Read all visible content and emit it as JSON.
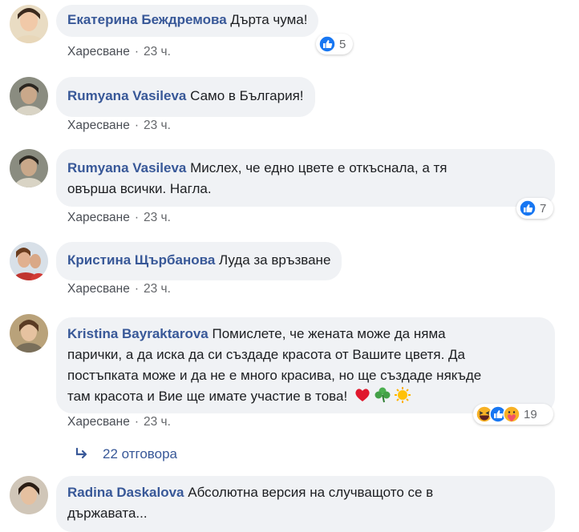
{
  "comments": [
    {
      "name": "Екатерина Беждремова",
      "text": " Дърта чума!",
      "like": "Харесване",
      "time": "23 ч.",
      "reactions": "5"
    },
    {
      "name": "Rumyana Vasileva",
      "text": " Само в България!",
      "like": "Харесване",
      "time": "23 ч."
    },
    {
      "name": "Rumyana Vasileva",
      "text": " Мислех, че едно цвете е откъснала, а тя",
      "text2": "овърша всички. Нагла.",
      "like": "Харесване",
      "time": "23 ч.",
      "reactions": "7"
    },
    {
      "name": "Кристина Щърбанова",
      "text": " Луда за връзване",
      "like": "Харесване",
      "time": "23 ч."
    },
    {
      "name": "Kristina Bayraktarova",
      "text": " Помислете, че жената може да няма",
      "text2": "парички, а да иска да си създаде красота от Вашите цветя. Да",
      "text3": "постъпката може и да не е много красива, но ще създаде някъде",
      "text4": "там красота и Вие ще имате участие в това!",
      "like": "Харесване",
      "time": "23 ч.",
      "reactions": "19",
      "replies": "22 отговора"
    },
    {
      "name": "Radina Daskalova",
      "text": " Абсолютна версия на случващото се в",
      "text2": "държавата..."
    }
  ],
  "separator": "·",
  "colors": {
    "name": "#385898",
    "bubble": "#f0f2f5",
    "meta": "#65676b",
    "like_blue": "#1877f2"
  },
  "icons": [
    "like-icon",
    "haha-icon",
    "care-icon",
    "heart-emoji-icon",
    "shamrock-emoji-icon",
    "sun-emoji-icon",
    "reply-arrow-icon"
  ]
}
